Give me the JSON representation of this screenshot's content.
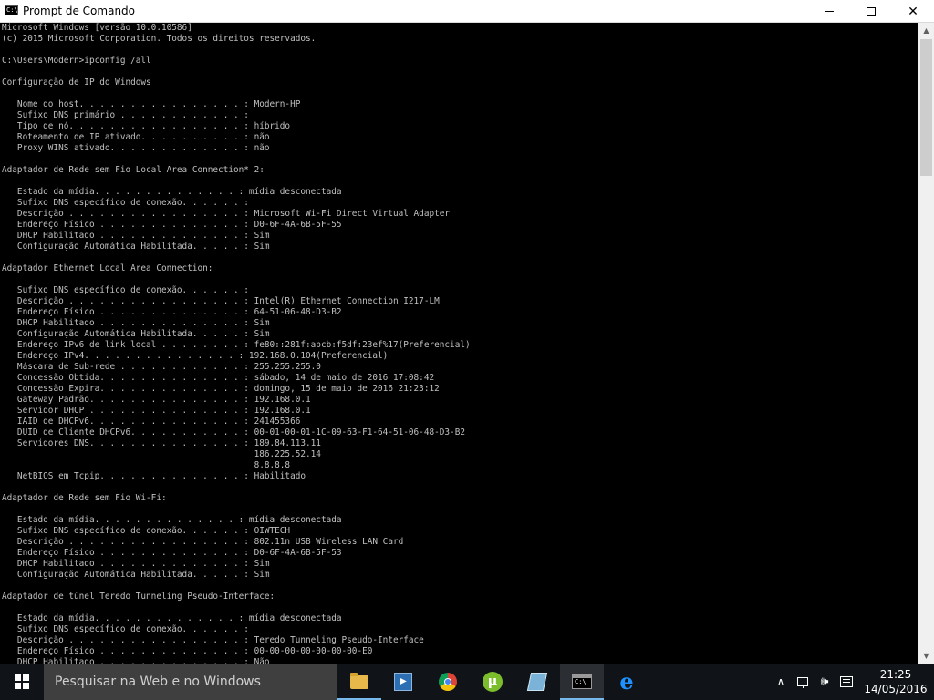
{
  "window": {
    "title": "Prompt de Comando",
    "icon_text": "C:\\",
    "minimize_icon": "minimize-icon",
    "maximize_icon": "restore-icon",
    "close_symbol": "✕"
  },
  "console": {
    "lines": [
      "Microsoft Windows [versão 10.0.10586]",
      "(c) 2015 Microsoft Corporation. Todos os direitos reservados.",
      "",
      "C:\\Users\\Modern>ipconfig /all",
      "",
      "Configuração de IP do Windows",
      "",
      "   Nome do host. . . . . . . . . . . . . . . . : Modern-HP",
      "   Sufixo DNS primário . . . . . . . . . . . . :",
      "   Tipo de nó. . . . . . . . . . . . . . . . . : híbrido",
      "   Roteamento de IP ativado. . . . . . . . . . : não",
      "   Proxy WINS ativado. . . . . . . . . . . . . : não",
      "",
      "Adaptador de Rede sem Fio Local Area Connection* 2:",
      "",
      "   Estado da mídia. . . . . . . . . . . . . . : mídia desconectada",
      "   Sufixo DNS específico de conexão. . . . . . :",
      "   Descrição . . . . . . . . . . . . . . . . . : Microsoft Wi-Fi Direct Virtual Adapter",
      "   Endereço Físico . . . . . . . . . . . . . . : D0-6F-4A-6B-5F-55",
      "   DHCP Habilitado . . . . . . . . . . . . . . : Sim",
      "   Configuração Automática Habilitada. . . . . : Sim",
      "",
      "Adaptador Ethernet Local Area Connection:",
      "",
      "   Sufixo DNS específico de conexão. . . . . . :",
      "   Descrição . . . . . . . . . . . . . . . . . : Intel(R) Ethernet Connection I217-LM",
      "   Endereço Físico . . . . . . . . . . . . . . : 64-51-06-48-D3-B2",
      "   DHCP Habilitado . . . . . . . . . . . . . . : Sim",
      "   Configuração Automática Habilitada. . . . . : Sim",
      "   Endereço IPv6 de link local . . . . . . . . : fe80::281f:abcb:f5df:23ef%17(Preferencial)",
      "   Endereço IPv4. . . . . . . . . . . . . . . : 192.168.0.104(Preferencial)",
      "   Máscara de Sub-rede . . . . . . . . . . . . : 255.255.255.0",
      "   Concessão Obtida. . . . . . . . . . . . . . : sábado, 14 de maio de 2016 17:08:42",
      "   Concessão Expira. . . . . . . . . . . . . . : domingo, 15 de maio de 2016 21:23:12",
      "   Gateway Padrão. . . . . . . . . . . . . . . : 192.168.0.1",
      "   Servidor DHCP . . . . . . . . . . . . . . . : 192.168.0.1",
      "   IAID de DHCPv6. . . . . . . . . . . . . . . : 241455366",
      "   DUID de Cliente DHCPv6. . . . . . . . . . . : 00-01-00-01-1C-09-63-F1-64-51-06-48-D3-B2",
      "   Servidores DNS. . . . . . . . . . . . . . . : 189.84.113.11",
      "                                                 186.225.52.14",
      "                                                 8.8.8.8",
      "   NetBIOS em Tcpip. . . . . . . . . . . . . . : Habilitado",
      "",
      "Adaptador de Rede sem Fio Wi-Fi:",
      "",
      "   Estado da mídia. . . . . . . . . . . . . . : mídia desconectada",
      "   Sufixo DNS específico de conexão. . . . . . : OIWTECH",
      "   Descrição . . . . . . . . . . . . . . . . . : 802.11n USB Wireless LAN Card",
      "   Endereço Físico . . . . . . . . . . . . . . : D0-6F-4A-6B-5F-53",
      "   DHCP Habilitado . . . . . . . . . . . . . . : Sim",
      "   Configuração Automática Habilitada. . . . . : Sim",
      "",
      "Adaptador de túnel Teredo Tunneling Pseudo-Interface:",
      "",
      "   Estado da mídia. . . . . . . . . . . . . . : mídia desconectada",
      "   Sufixo DNS específico de conexão. . . . . . :",
      "   Descrição . . . . . . . . . . . . . . . . . : Teredo Tunneling Pseudo-Interface",
      "   Endereço Físico . . . . . . . . . . . . . . : 00-00-00-00-00-00-00-E0",
      "   DHCP Habilitado . . . . . . . . . . . . . . : Não"
    ]
  },
  "scrollbar": {
    "up_arrow": "▲",
    "down_arrow": "▼"
  },
  "taskbar": {
    "search_placeholder": "Pesquisar na Web e no Windows",
    "pinned": [
      {
        "name": "file-explorer-icon"
      },
      {
        "name": "media-player-icon",
        "glyph": "▶"
      },
      {
        "name": "chrome-icon"
      },
      {
        "name": "utorrent-icon",
        "glyph": "µ"
      },
      {
        "name": "sticky-notes-icon"
      },
      {
        "name": "command-prompt-icon",
        "glyph": "C:\\_"
      },
      {
        "name": "edge-icon",
        "glyph": "e"
      }
    ],
    "tray": {
      "chevron": "∧",
      "volume_glyph": "🕪"
    },
    "clock": {
      "time": "21:25",
      "date": "14/05/2016"
    }
  },
  "colors": {
    "console_bg": "#000000",
    "console_fg": "#c0c0c0",
    "taskbar_bg": "#101418",
    "search_bg": "#3f3f3f",
    "active_indicator": "#76b9ed"
  }
}
